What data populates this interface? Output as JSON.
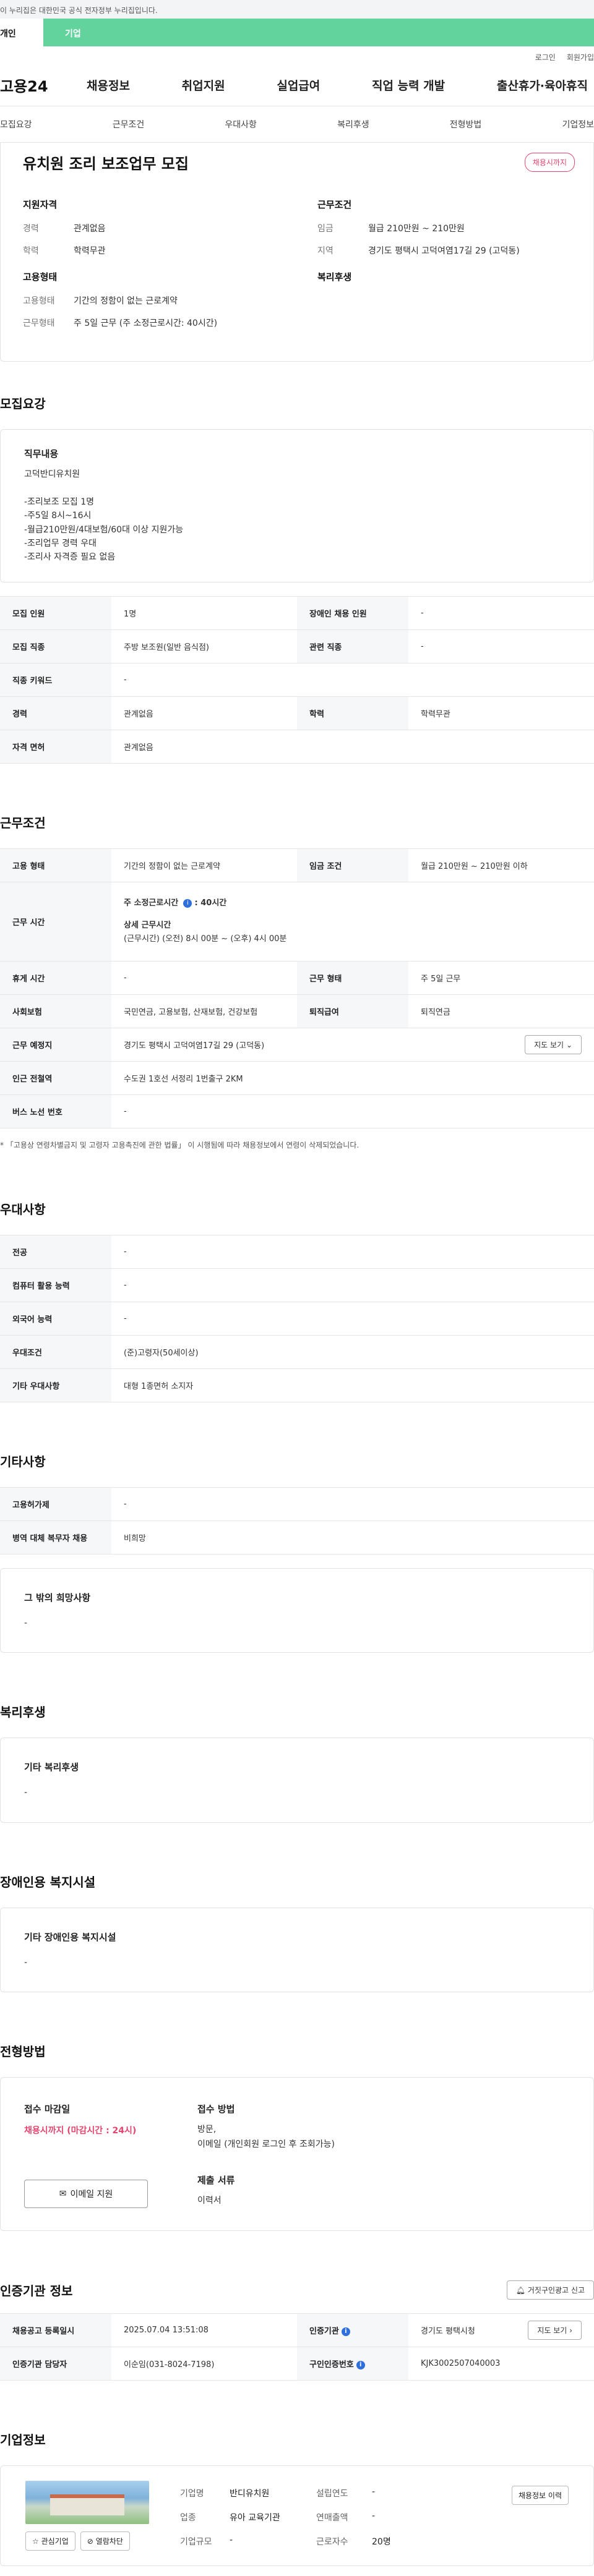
{
  "banner": "이 누리집은 대한민국 공식 전자정부 누리집입니다.",
  "usertype": {
    "individual": "개인",
    "corporate": "기업"
  },
  "util": {
    "login": "로그인",
    "signup": "회원가입"
  },
  "logo": "고용24",
  "gnb": [
    "채용정보",
    "취업지원",
    "실업급여",
    "직업 능력 개발",
    "출산휴가·육아휴직"
  ],
  "subnav": [
    "모집요강",
    "근무조건",
    "우대사항",
    "복리후생",
    "전형방법",
    "기업정보"
  ],
  "summary": {
    "title": "유치원 조리 보조업무 모집",
    "badge": "채용시까지",
    "qual_title": "지원자격",
    "qual": [
      {
        "k": "경력",
        "v": "관계없음"
      },
      {
        "k": "학력",
        "v": "학력무관"
      }
    ],
    "emp_title": "고용형태",
    "emp": [
      {
        "k": "고용형태",
        "v": "기간의 정함이 없는 근로계약"
      },
      {
        "k": "근무형태",
        "v": "주 5일 근무 (주 소정근로시간: 40시간)"
      }
    ],
    "cond_title": "근무조건",
    "cond": [
      {
        "k": "임금",
        "v": "월급 210만원 ~ 210만원"
      },
      {
        "k": "지역",
        "v": "경기도 평택시 고덕여염17길 29 (고덕동)"
      }
    ],
    "welfare_title": "복리후생"
  },
  "recruit": {
    "title": "모집요강",
    "duty_title": "직무내용",
    "duty_text": "고덕반디유치원\n\n-조리보조 모집 1명\n-주5일 8시~16시\n-월급210만원/4대보험/60대 이상 지원가능\n-조리업무 경력 우대\n-조리사 자격증 필요 없음",
    "rows": [
      [
        "모집 인원",
        "1명",
        "장애인 채용 인원",
        "-"
      ],
      [
        "모집 직종",
        "주방 보조원(일반 음식점)",
        "관련 직종",
        "-"
      ],
      [
        "직종 키워드",
        "-"
      ],
      [
        "경력",
        "관계없음",
        "학력",
        "학력무관"
      ],
      [
        "자격 면허",
        "관계없음"
      ]
    ]
  },
  "work": {
    "title": "근무조건",
    "emp_type_k": "고용 형태",
    "emp_type_v": "기간의 정함이 없는 근로계약",
    "wage_k": "임금 조건",
    "wage_v": "월급 210만원 ~ 210만원 이하",
    "hours_k": "근무 시간",
    "hours_title": "주 소정근로시간",
    "hours_value": ": 40시간",
    "hours_detail_title": "상세 근무시간",
    "hours_detail": "(근무시간) (오전) 8시 00분 ~ (오후) 4시 00분",
    "rest_k": "휴게 시간",
    "rest_v": "-",
    "form_k": "근무 형태",
    "form_v": "주 5일 근무",
    "ins_k": "사회보험",
    "ins_v": "국민연금, 고용보험, 산재보험, 건강보험",
    "sev_k": "퇴직급여",
    "sev_v": "퇴직연금",
    "place_k": "근무 예정지",
    "place_v": "경기도 평택시 고덕여염17길 29 (고덕동)",
    "map_btn": "지도 보기",
    "station_k": "인근 전철역",
    "station_v": "수도권 1호선 서정리 1번출구 2KM",
    "bus_k": "버스 노선 번호",
    "bus_v": "-",
    "note": "* 「고용상 연령차별금지 및 고령자 고용촉진에 관한 법률」 이 시행됨에 따라 채용정보에서 연령이 삭제되었습니다."
  },
  "pref": {
    "title": "우대사항",
    "rows": [
      [
        "전공",
        "-"
      ],
      [
        "컴퓨터 활용 능력",
        "-"
      ],
      [
        "외국어 능력",
        "-"
      ],
      [
        "우대조건",
        "(준)고령자(50세이상)"
      ],
      [
        "기타 우대사항",
        "대형 1종면허 소지자"
      ]
    ]
  },
  "etc": {
    "title": "기타사항",
    "rows": [
      [
        "고용허가제",
        "-"
      ],
      [
        "병역 대체 복무자 채용",
        "비희망"
      ]
    ],
    "wish_title": "그 밖의 희망사항",
    "wish_text": "-"
  },
  "welfare": {
    "title": "복리후생",
    "box_title": "기타 복리후생",
    "box_text": "-"
  },
  "disabled": {
    "title": "장애인용 복지시설",
    "box_title": "기타 장애인용 복지시설",
    "box_text": "-"
  },
  "apply": {
    "title": "전형방법",
    "deadline_title": "접수 마감일",
    "deadline": "채용시까지 (마감시간 : 24시)",
    "email_btn": "이메일 지원",
    "method_title": "접수 방법",
    "method": "방문,\n이메일 (개인회원 로그인 후 조회가능)",
    "docs_title": "제출 서류",
    "docs": "이력서"
  },
  "cert": {
    "title": "인증기관 정보",
    "report_btn": "거짓구인광고 신고",
    "reg_k": "채용공고 등록일시",
    "reg_v": "2025.07.04 13:51:08",
    "org_k": "인증기관",
    "org_v": "경기도 평택시청",
    "map_btn": "지도 보기",
    "mgr_k": "인증기관 담당자",
    "mgr_v": "이순임(031-8024-7198)",
    "no_k": "구인인증번호",
    "no_v": "KJK3002507040003"
  },
  "company": {
    "title": "기업정보",
    "fav_btn": "관심기업",
    "block_btn": "열람차단",
    "history_btn": "채용정보 이력",
    "name_k": "기업명",
    "name_v": "반디유치원",
    "year_k": "설립연도",
    "year_v": "-",
    "ind_k": "업종",
    "ind_v": "유아 교육기관",
    "sales_k": "연매출액",
    "sales_v": "-",
    "size_k": "기업규모",
    "size_v": "-",
    "emp_k": "근로자수",
    "emp_v": "20명"
  }
}
